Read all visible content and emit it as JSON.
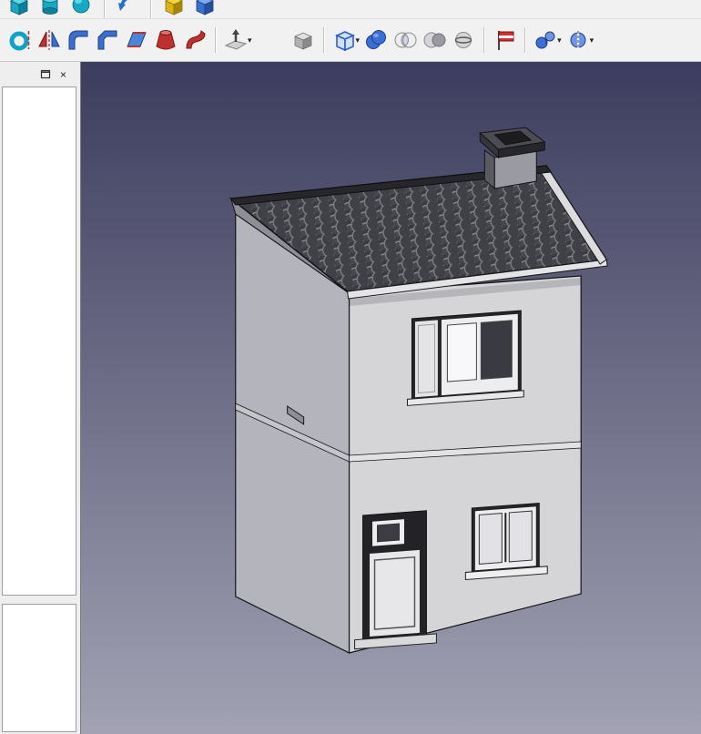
{
  "window": {
    "panel_close_label": "×",
    "caret": "▾"
  },
  "toolbar_top": {
    "icons": [
      "primitive-box",
      "primitive-cylinder",
      "primitive-sphere",
      "rotate-view-arrow",
      "yellow-solid",
      "blue-solid"
    ]
  },
  "toolbar_part": {
    "icons": [
      "part-revolve",
      "part-mirror",
      "part-fillet",
      "part-chamfer",
      "part-ruled-surface",
      "part-loft",
      "part-sweep",
      "part-extrude",
      "part-thickness",
      "part-compound",
      "part-boolean-union",
      "part-boolean-common",
      "part-boolean-cut",
      "part-cross-section",
      "part-defeaturing",
      "part-join-connect",
      "part-boolean-split"
    ],
    "dropdown_buttons": [
      "part-extrude",
      "part-compound",
      "part-join-connect",
      "part-boolean-split"
    ]
  },
  "sidebar": {
    "tree_view_items": [],
    "property_rows": []
  },
  "viewport": {
    "background_top": "#3c3c5e",
    "background_bottom": "#a2a2b4",
    "model": {
      "name": "two-story-house",
      "parts": [
        "tiled-gable-roof",
        "ridge-cap",
        "chimney",
        "front-wall",
        "left-wall",
        "floor-ledge",
        "upper-window-with-shutter",
        "lower-window",
        "front-door",
        "door-step"
      ],
      "wall_color": "#d5d5d7",
      "side_wall_color": "#b4b4bc",
      "roof_color": "#3b3b41",
      "edge_color": "#141417"
    }
  }
}
